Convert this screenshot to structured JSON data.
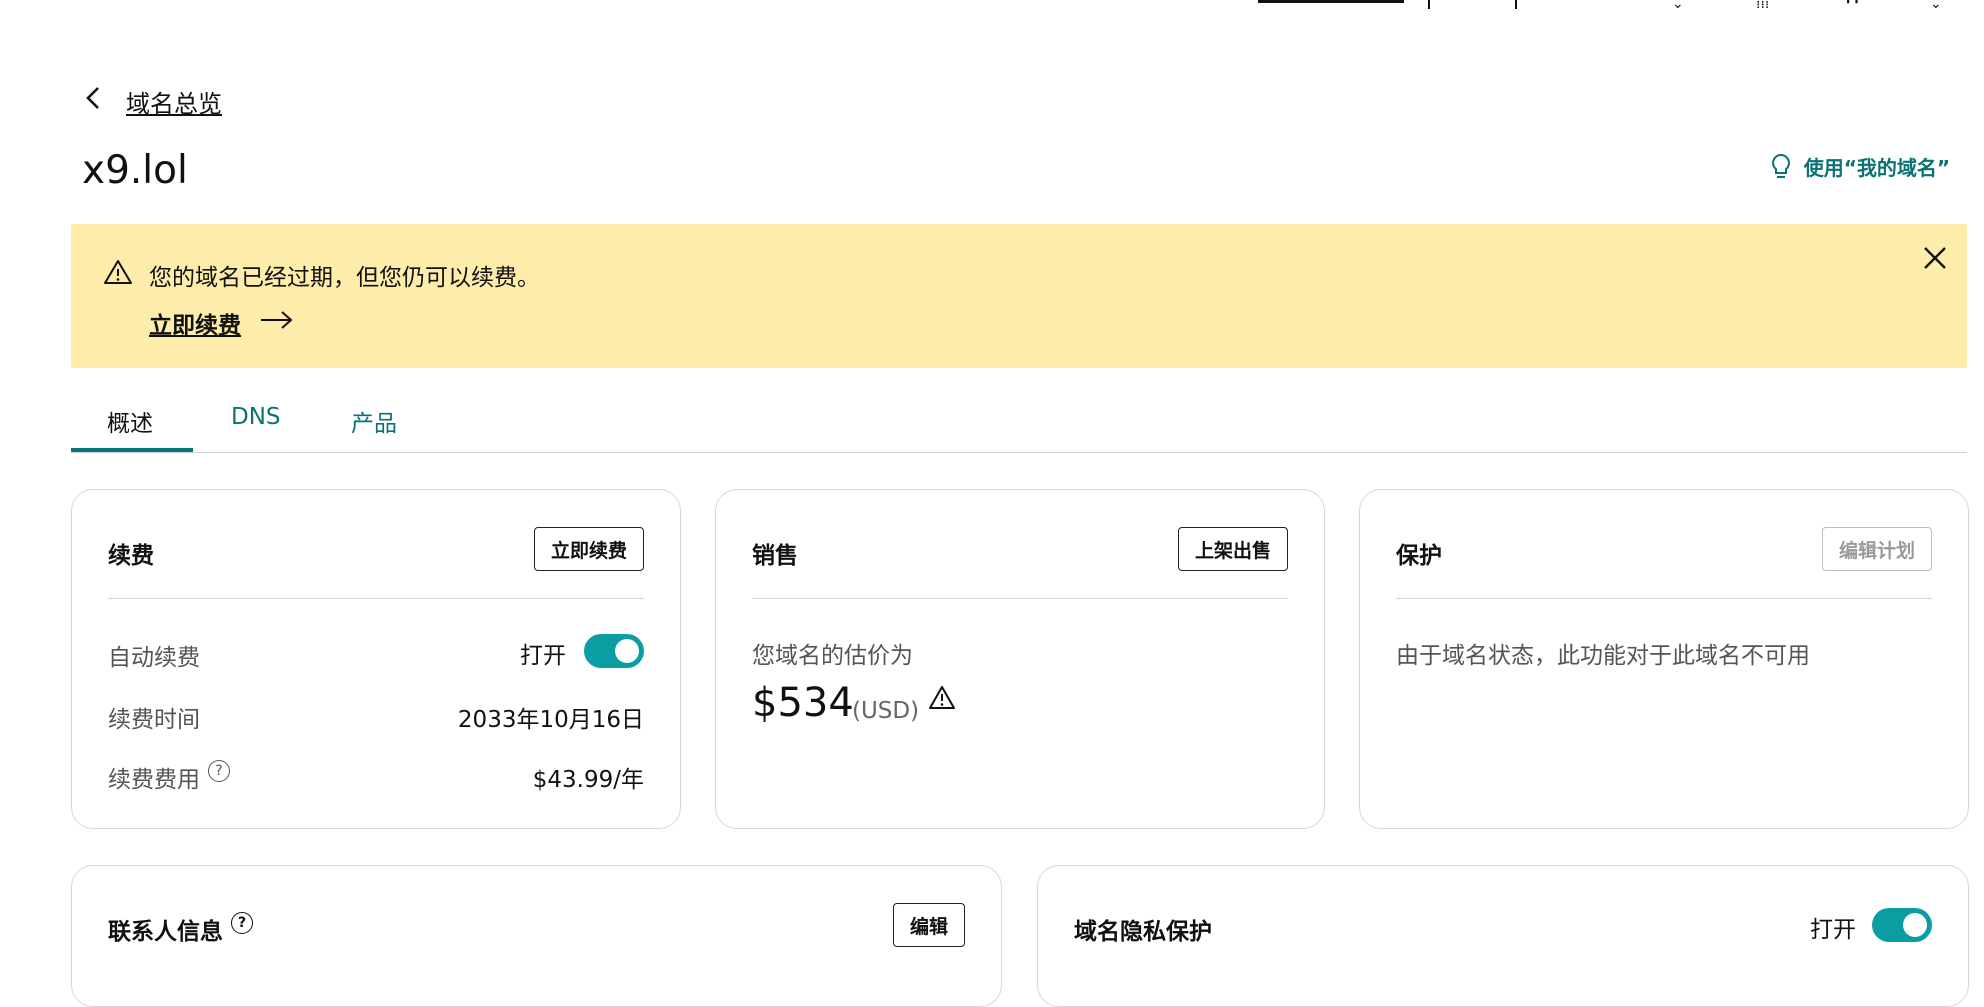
{
  "header": {
    "back_label": "域名总览",
    "domain_title": "x9.lol",
    "tip_label": "使用“我的域名”"
  },
  "banner": {
    "message": "您的域名已经过期，但您仍可以续费。",
    "action_label": "立即续费"
  },
  "tabs": [
    {
      "label": "概述",
      "active": true
    },
    {
      "label": "DNS",
      "active": false
    },
    {
      "label": "产品",
      "active": false
    }
  ],
  "renewal_card": {
    "title": "续费",
    "button_label": "立即续费",
    "auto_renew_label": "自动续费",
    "auto_renew_state": "打开",
    "renew_date_label": "续费时间",
    "renew_date_value": "2033年10月16日",
    "renew_fee_label": "续费费用",
    "renew_fee_value": "$43.99/年"
  },
  "sale_card": {
    "title": "销售",
    "button_label": "上架出售",
    "estimate_label": "您域名的估价为",
    "estimate_value": "$534",
    "estimate_unit": "(USD)"
  },
  "protection_card": {
    "title": "保护",
    "button_label": "编辑计划",
    "message": "由于域名状态，此功能对于此域名不可用"
  },
  "contact_card": {
    "title": "联系人信息",
    "button_label": "编辑"
  },
  "privacy_card": {
    "title": "域名隐私保护",
    "state": "打开"
  },
  "colors": {
    "accent": "#0a9ea2",
    "tab_accent": "#0b7175",
    "banner_bg": "#feecaa"
  }
}
